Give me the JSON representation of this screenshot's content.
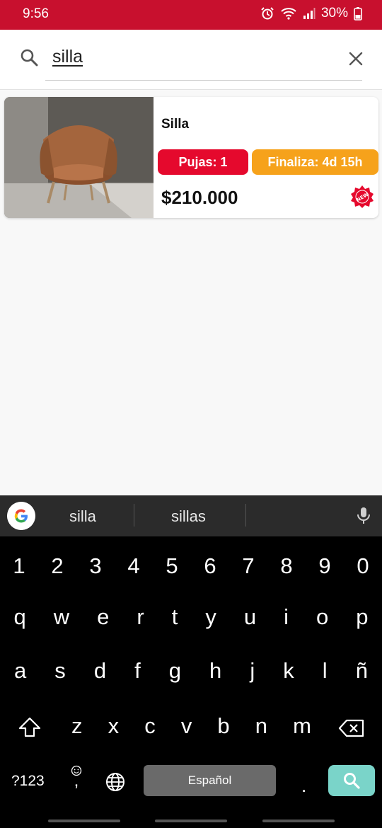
{
  "status_bar": {
    "time": "9:56",
    "battery": "30%"
  },
  "search": {
    "query": "silla"
  },
  "results": [
    {
      "title": "Silla",
      "bids_label": "Pujas: 1",
      "ends_label": "Finaliza: 4d 15h",
      "price": "$210.000",
      "new_badge": "NEW"
    }
  ],
  "keyboard": {
    "suggestions": [
      "silla",
      "sillas"
    ],
    "numbers": [
      "1",
      "2",
      "3",
      "4",
      "5",
      "6",
      "7",
      "8",
      "9",
      "0"
    ],
    "row1": [
      "q",
      "w",
      "e",
      "r",
      "t",
      "y",
      "u",
      "i",
      "o",
      "p"
    ],
    "row2": [
      "a",
      "s",
      "d",
      "f",
      "g",
      "h",
      "j",
      "k",
      "l",
      "ñ"
    ],
    "row3": [
      "z",
      "x",
      "c",
      "v",
      "b",
      "n",
      "m"
    ],
    "symbols_key": "?123",
    "comma_key": ",",
    "space_label": "Español",
    "period_key": "."
  },
  "colors": {
    "brand_red": "#c8102e",
    "bids_red": "#e5092d",
    "ends_orange": "#f6a21b",
    "search_key": "#7ad4c9"
  }
}
